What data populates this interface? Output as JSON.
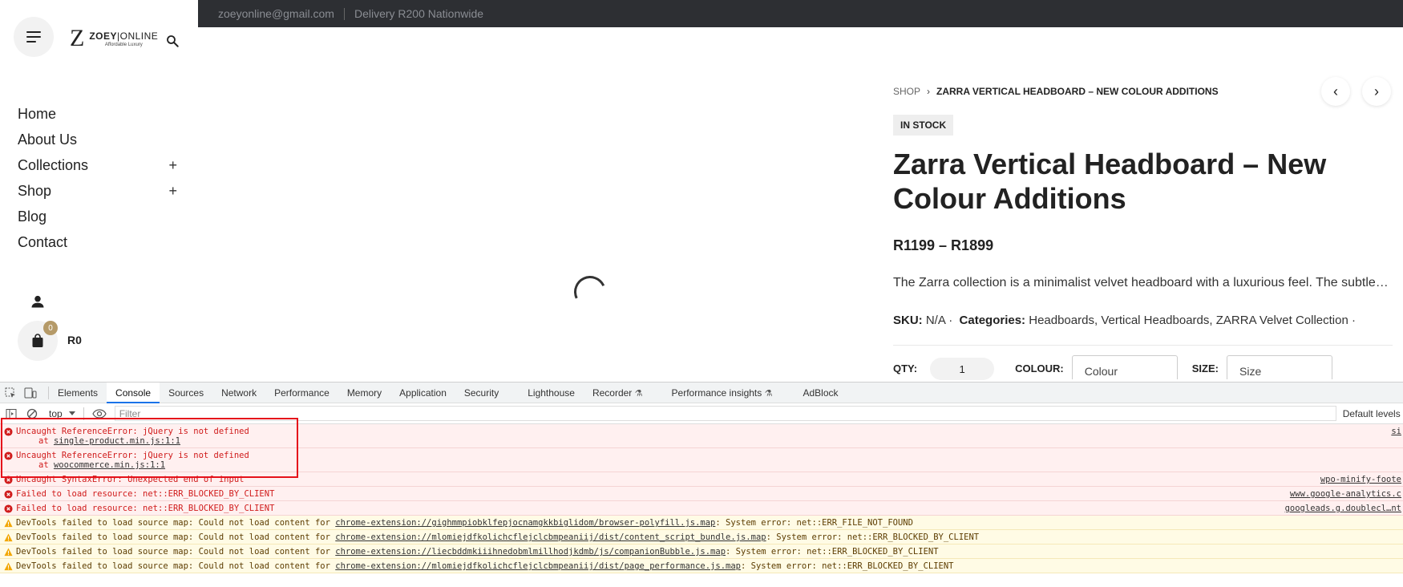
{
  "topbar": {
    "email": "zoeyonline@gmail.com",
    "delivery": "Delivery R200 Nationwide"
  },
  "logo": {
    "mark": "Z",
    "name_bold": "ZOEY",
    "name_thin": "ONLINE",
    "tagline": "Affordable Luxury"
  },
  "nav": {
    "items": [
      {
        "label": "Home",
        "expandable": false
      },
      {
        "label": "About Us",
        "expandable": false
      },
      {
        "label": "Collections",
        "expandable": true
      },
      {
        "label": "Shop",
        "expandable": true
      },
      {
        "label": "Blog",
        "expandable": false
      },
      {
        "label": "Contact",
        "expandable": false
      }
    ],
    "plus": "+"
  },
  "cart": {
    "count": "0",
    "total": "R0"
  },
  "product": {
    "breadcrumb_shop": "SHOP",
    "breadcrumb_current": "ZARRA VERTICAL HEADBOARD – NEW COLOUR ADDITIONS",
    "stock": "IN STOCK",
    "title": "Zarra Vertical Headboard – New Colour Additions",
    "price": "R1199 – R1899",
    "description": "The Zarra collection is a minimalist velvet headboard with a luxurious feel. The subtle vertical channelling design adds depth and texture.",
    "sku_label": "SKU:",
    "sku": "N/A",
    "categories_label": "Categories:",
    "categories": [
      "Headboards",
      "Vertical Headboards",
      "ZARRA Velvet Collection"
    ],
    "qty_label": "QTY:",
    "qty": "1",
    "colour_label": "COLOUR:",
    "colour_placeholder": "Colour",
    "size_label": "SIZE:",
    "size_placeholder": "Size"
  },
  "devtools": {
    "tabs": [
      "Elements",
      "Console",
      "Sources",
      "Network",
      "Performance",
      "Memory",
      "Application",
      "Security",
      "Lighthouse",
      "Recorder",
      "Performance insights",
      "AdBlock"
    ],
    "active_tab": "Console",
    "context": "top",
    "filter_placeholder": "Filter",
    "levels": "Default levels",
    "log": [
      {
        "level": "error",
        "text": "Uncaught ReferenceError: jQuery is not defined",
        "at": "single-product.min.js:1:1",
        "source": "si"
      },
      {
        "level": "error",
        "text": "Uncaught ReferenceError: jQuery is not defined",
        "at": "woocommerce.min.js:1:1",
        "source": ""
      },
      {
        "level": "error",
        "text": "Uncaught SyntaxError: Unexpected end of input",
        "at": "",
        "source": "wpo-minify-foote"
      },
      {
        "level": "error",
        "text": "Failed to load resource: net::ERR_BLOCKED_BY_CLIENT",
        "at": "",
        "source": "www.google-analytics.c"
      },
      {
        "level": "error",
        "text": "Failed to load resource: net::ERR_BLOCKED_BY_CLIENT",
        "at": "",
        "source": "googleads.g.doublecl…nt"
      },
      {
        "level": "warning",
        "prefix": "DevTools failed to load source map: Could not load content for ",
        "link": "chrome-extension://gighmmpiobklfepjocnamgkkbiglidom/browser-polyfill.js.map",
        "suffix": ": System error: net::ERR_FILE_NOT_FOUND"
      },
      {
        "level": "warning",
        "prefix": "DevTools failed to load source map: Could not load content for ",
        "link": "chrome-extension://mlomiejdfkolichcflejclcbmpeaniij/dist/content_script_bundle.js.map",
        "suffix": ": System error: net::ERR_BLOCKED_BY_CLIENT"
      },
      {
        "level": "warning",
        "prefix": "DevTools failed to load source map: Could not load content for ",
        "link": "chrome-extension://liecbddmkiiihnedobmlmillhodjkdmb/js/companionBubble.js.map",
        "suffix": ": System error: net::ERR_BLOCKED_BY_CLIENT"
      },
      {
        "level": "warning",
        "prefix": "DevTools failed to load source map: Could not load content for ",
        "link": "chrome-extension://mlomiejdfkolichcflejclcbmpeaniij/dist/page_performance.js.map",
        "suffix": ": System error: net::ERR_BLOCKED_BY_CLIENT"
      }
    ]
  },
  "colors": {
    "topbar": "#2d2f33",
    "badge_gold": "#b59a68",
    "error_red": "#d01b1b",
    "highlight": "#e5121b",
    "devtools_active": "#1a73e8"
  }
}
